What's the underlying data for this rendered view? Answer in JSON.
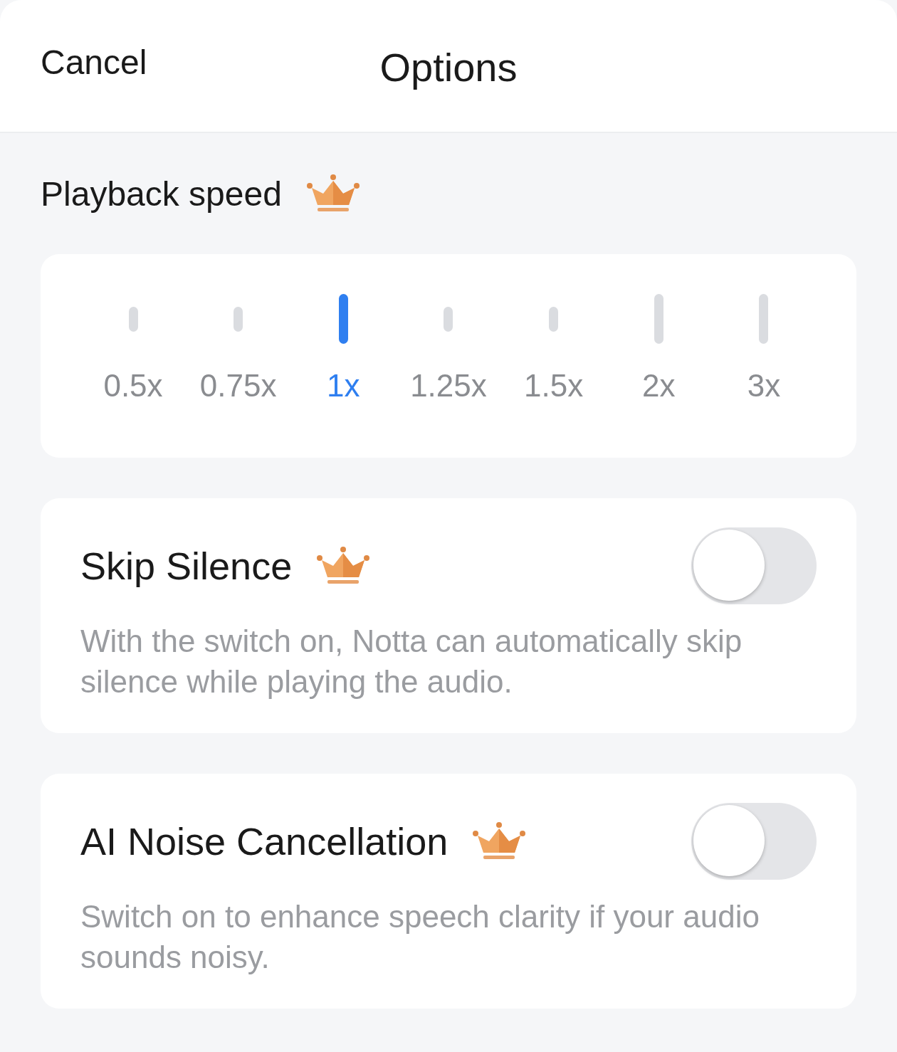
{
  "header": {
    "cancel": "Cancel",
    "title": "Options"
  },
  "playback": {
    "label": "Playback speed",
    "premium": true,
    "speeds": [
      {
        "label": "0.5x",
        "major": false,
        "selected": false
      },
      {
        "label": "0.75x",
        "major": false,
        "selected": false
      },
      {
        "label": "1x",
        "major": true,
        "selected": true
      },
      {
        "label": "1.25x",
        "major": false,
        "selected": false
      },
      {
        "label": "1.5x",
        "major": false,
        "selected": false
      },
      {
        "label": "2x",
        "major": true,
        "selected": false
      },
      {
        "label": "3x",
        "major": true,
        "selected": false
      }
    ]
  },
  "settings": [
    {
      "title": "Skip Silence",
      "premium": true,
      "on": false,
      "description": "With the switch on, Notta can automatically skip silence while playing the audio."
    },
    {
      "title": "AI Noise Cancellation",
      "premium": true,
      "on": false,
      "description": "Switch on to enhance speech clarity if your audio sounds noisy."
    }
  ]
}
